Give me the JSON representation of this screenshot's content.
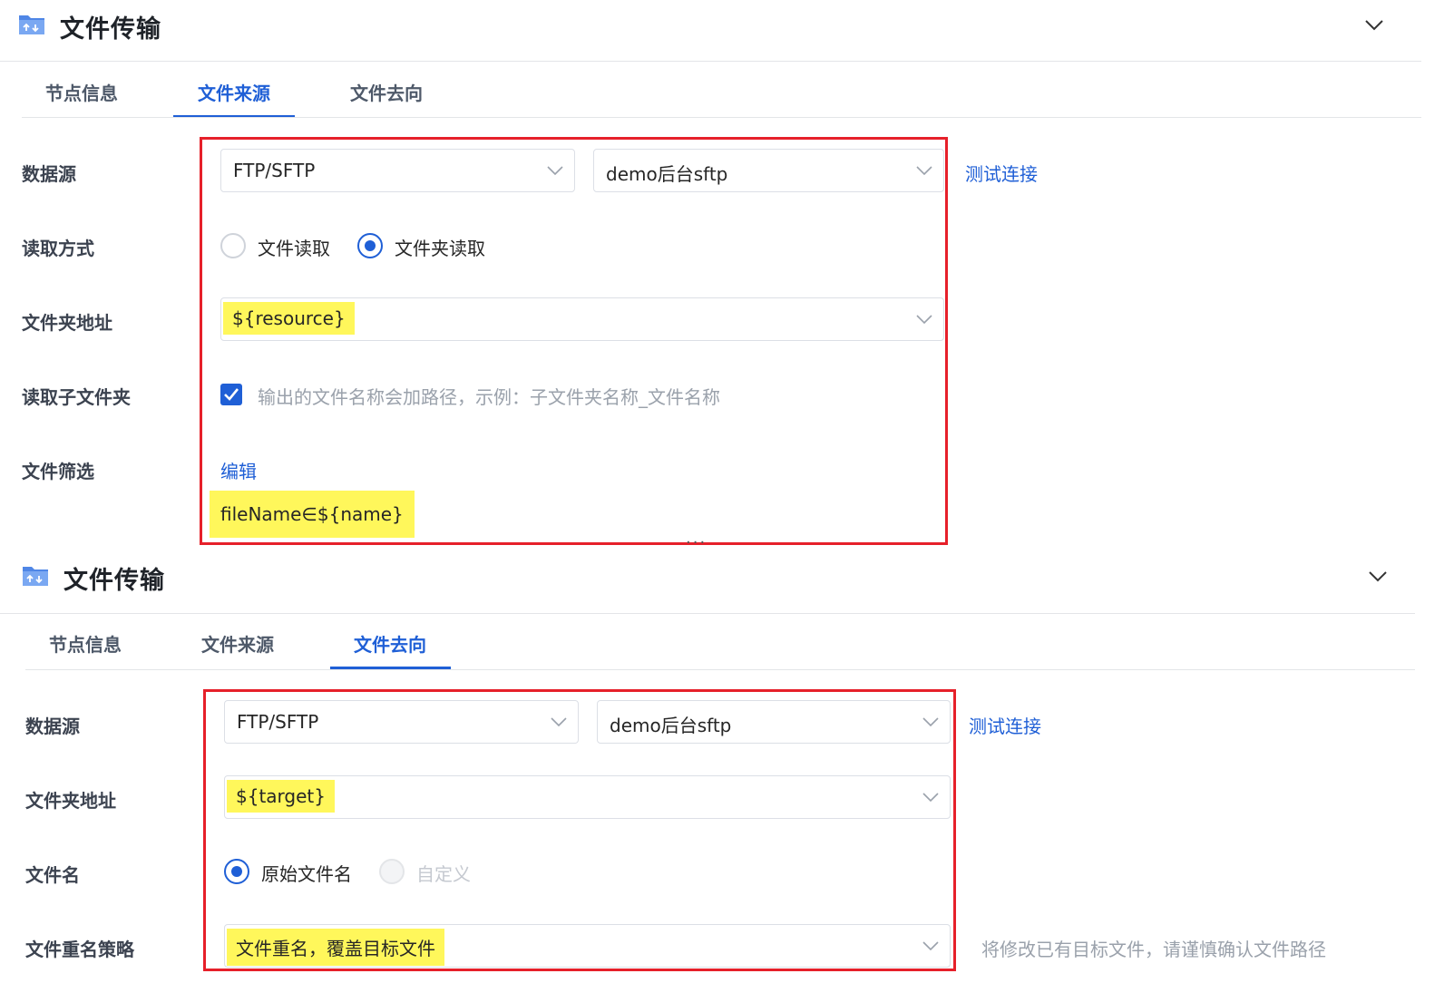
{
  "panel1": {
    "title": "文件传输",
    "tabs": [
      "节点信息",
      "文件来源",
      "文件去向"
    ],
    "active_tab": 1,
    "labels": {
      "datasource": "数据源",
      "read_mode": "读取方式",
      "folder_path": "文件夹地址",
      "read_subfolder": "读取子文件夹",
      "file_filter": "文件筛选"
    },
    "datasource_type": "FTP/SFTP",
    "datasource_name": "demo后台sftp",
    "test_connection": "测试连接",
    "read_options": [
      "文件读取",
      "文件夹读取"
    ],
    "read_selected": 1,
    "folder_value": "${resource}",
    "subfolder_checked": true,
    "subfolder_hint": "输出的文件名称会加路径，示例：子文件夹名称_文件名称",
    "edit_link": "编辑",
    "filter_expression": "fileName∈${name}"
  },
  "separator_dots": "···",
  "panel2": {
    "title": "文件传输",
    "tabs": [
      "节点信息",
      "文件来源",
      "文件去向"
    ],
    "active_tab": 2,
    "labels": {
      "datasource": "数据源",
      "folder_path": "文件夹地址",
      "file_name": "文件名",
      "rename_policy": "文件重名策略"
    },
    "datasource_type": "FTP/SFTP",
    "datasource_name": "demo后台sftp",
    "test_connection": "测试连接",
    "folder_value": "${target}",
    "filename_options": [
      "原始文件名",
      "自定义"
    ],
    "filename_selected": 0,
    "rename_value": "文件重名，覆盖目标文件",
    "rename_hint": "将修改已有目标文件，请谨慎确认文件路径"
  },
  "colors": {
    "accent": "#1f5fd6",
    "highlight": "#fff75b",
    "annotation_box": "#e6202a"
  }
}
